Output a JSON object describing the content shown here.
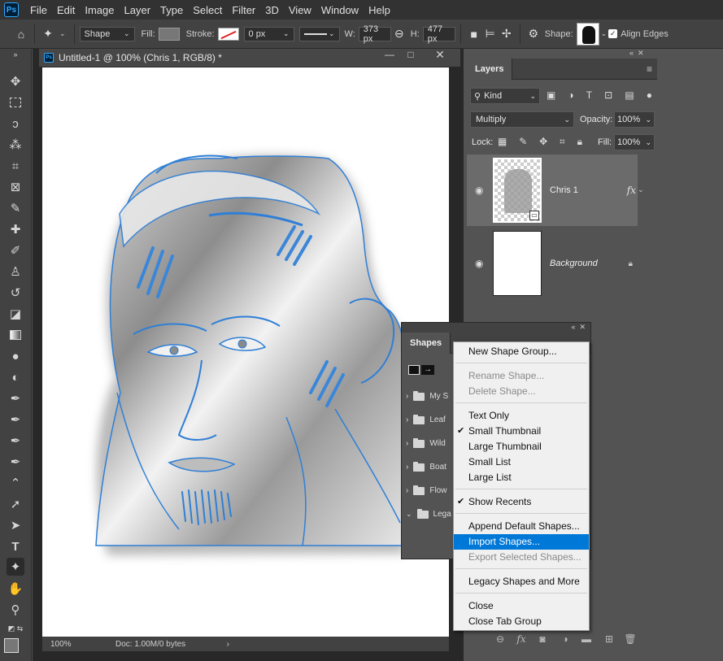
{
  "menubar": {
    "logo": "Ps",
    "items": [
      "File",
      "Edit",
      "Image",
      "Layer",
      "Type",
      "Select",
      "Filter",
      "3D",
      "View",
      "Window",
      "Help"
    ]
  },
  "options": {
    "mode": "Shape",
    "fill_label": "Fill:",
    "stroke_label": "Stroke:",
    "stroke_width": "0 px",
    "w_label": "W:",
    "w_value": "373 px",
    "h_label": "H:",
    "h_value": "477 px",
    "shape_label": "Shape:",
    "align_edges": "Align Edges"
  },
  "document": {
    "tab_title": "Untitled-1 @ 100% (Chris 1, RGB/8) *",
    "zoom": "100%",
    "doc_info": "Doc: 1.00M/0 bytes"
  },
  "layers": {
    "tab": "Layers",
    "filter_kind": "Kind",
    "blend_mode": "Multiply",
    "opacity_label": "Opacity:",
    "opacity": "100%",
    "lock_label": "Lock:",
    "fill_label": "Fill:",
    "fill": "100%",
    "items": [
      {
        "name": "Chris 1",
        "fx": "fx"
      },
      {
        "name": "Background"
      }
    ]
  },
  "shapes": {
    "tab": "Shapes",
    "groups": [
      "My S",
      "Leaf",
      "Wild",
      "Boat",
      "Flow",
      "Lega"
    ]
  },
  "context_menu": {
    "items": [
      {
        "label": "New Shape Group...",
        "disabled": false
      },
      {
        "label": "Rename Shape...",
        "disabled": true
      },
      {
        "label": "Delete Shape...",
        "disabled": true
      },
      {
        "label": "Text Only",
        "disabled": false
      },
      {
        "label": "Small Thumbnail",
        "disabled": false,
        "checked": true
      },
      {
        "label": "Large Thumbnail",
        "disabled": false
      },
      {
        "label": "Small List",
        "disabled": false
      },
      {
        "label": "Large List",
        "disabled": false
      },
      {
        "label": "Show Recents",
        "disabled": false,
        "checked": true
      },
      {
        "label": "Append Default Shapes...",
        "disabled": false
      },
      {
        "label": "Import Shapes...",
        "disabled": false,
        "highlighted": true
      },
      {
        "label": "Export Selected Shapes...",
        "disabled": true
      },
      {
        "label": "Legacy Shapes and More",
        "disabled": false
      },
      {
        "label": "Close",
        "disabled": false
      },
      {
        "label": "Close Tab Group",
        "disabled": false
      }
    ],
    "check_glyph": "✔"
  },
  "colors": {
    "highlight": "#0078d7",
    "shape_stroke": "#2f7fd6"
  }
}
